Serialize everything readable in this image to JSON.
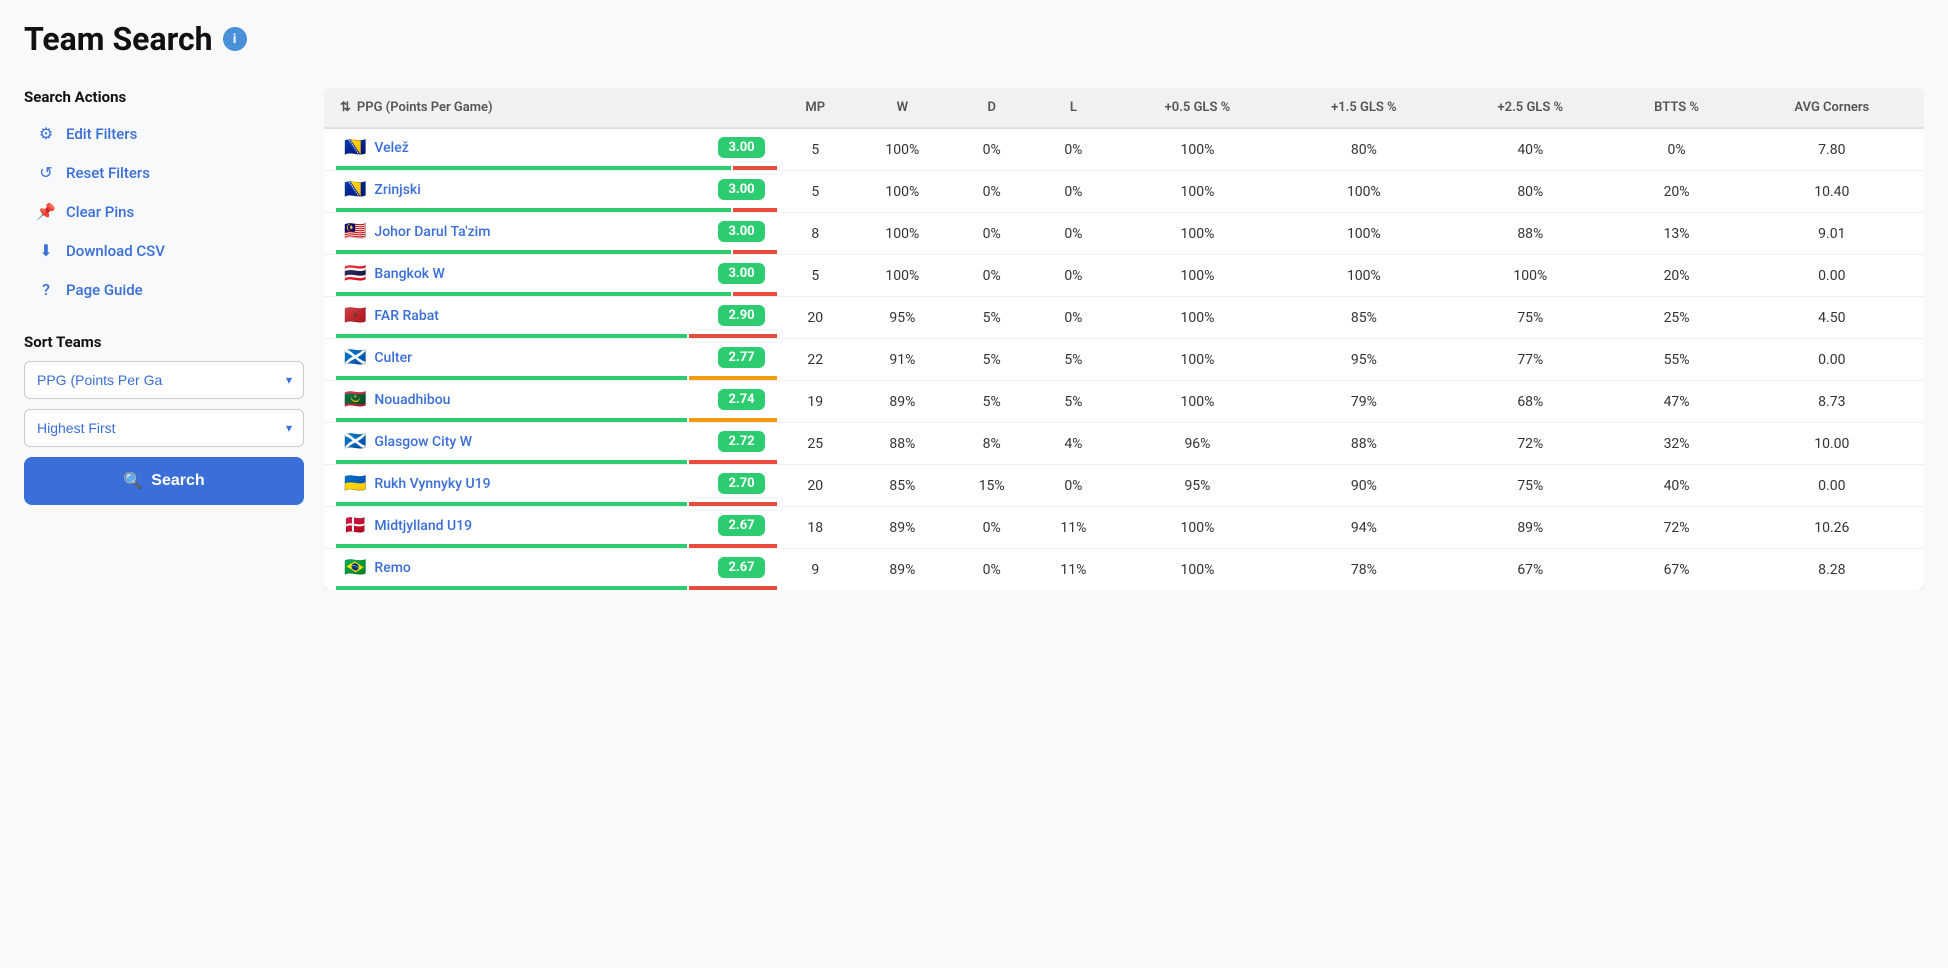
{
  "page": {
    "title": "Team Search",
    "info_icon": "i"
  },
  "sidebar": {
    "search_actions_label": "Search Actions",
    "actions": [
      {
        "id": "edit-filters",
        "label": "Edit Filters",
        "icon": "⚙"
      },
      {
        "id": "reset-filters",
        "label": "Reset Filters",
        "icon": "↺"
      },
      {
        "id": "clear-pins",
        "label": "Clear Pins",
        "icon": "📌"
      },
      {
        "id": "download-csv",
        "label": "Download CSV",
        "icon": "⬇"
      },
      {
        "id": "page-guide",
        "label": "Page Guide",
        "icon": "?"
      }
    ],
    "sort_label": "Sort Teams",
    "sort_by_label": "PPG (Points Per Ga",
    "sort_order_label": "Highest First",
    "search_button_label": "Search"
  },
  "table": {
    "sort_column_label": "PPG (Points Per Game)",
    "columns": [
      "MP",
      "W",
      "D",
      "L",
      "+0.5 GLS %",
      "+1.5 GLS %",
      "+2.5 GLS %",
      "BTTS %",
      "AVG Corners"
    ],
    "rows": [
      {
        "flag": "🇧🇦",
        "name": "Velež",
        "ppg": "3.00",
        "mp": 5,
        "w": "100%",
        "d": "0%",
        "l": "0%",
        "gls05": "100%",
        "gls15": "80%",
        "gls25": "40%",
        "btts": "0%",
        "avg_corners": "7.80",
        "bar": "green-heavy"
      },
      {
        "flag": "🇧🇦",
        "name": "Zrinjski",
        "ppg": "3.00",
        "mp": 5,
        "w": "100%",
        "d": "0%",
        "l": "0%",
        "gls05": "100%",
        "gls15": "100%",
        "gls25": "80%",
        "btts": "20%",
        "avg_corners": "10.40",
        "bar": "green-heavy"
      },
      {
        "flag": "🇲🇾",
        "name": "Johor Darul Ta'zim",
        "ppg": "3.00",
        "mp": 8,
        "w": "100%",
        "d": "0%",
        "l": "0%",
        "gls05": "100%",
        "gls15": "100%",
        "gls25": "88%",
        "btts": "13%",
        "avg_corners": "9.01",
        "bar": "green-heavy"
      },
      {
        "flag": "🇹🇭",
        "name": "Bangkok W",
        "ppg": "3.00",
        "mp": 5,
        "w": "100%",
        "d": "0%",
        "l": "0%",
        "gls05": "100%",
        "gls15": "100%",
        "gls25": "100%",
        "btts": "20%",
        "avg_corners": "0.00",
        "bar": "green-heavy"
      },
      {
        "flag": "🇲🇦",
        "name": "FAR Rabat",
        "ppg": "2.90",
        "mp": 20,
        "w": "95%",
        "d": "5%",
        "l": "0%",
        "gls05": "100%",
        "gls15": "85%",
        "gls25": "75%",
        "btts": "25%",
        "avg_corners": "4.50",
        "bar": "green-red"
      },
      {
        "flag": "🏴󠁧󠁢󠁳󠁣󠁴󠁿",
        "name": "Culter",
        "ppg": "2.77",
        "mp": 22,
        "w": "91%",
        "d": "5%",
        "l": "5%",
        "gls05": "100%",
        "gls15": "95%",
        "gls25": "77%",
        "btts": "55%",
        "avg_corners": "0.00",
        "bar": "green-orange"
      },
      {
        "flag": "🇲🇷",
        "name": "Nouadhibou",
        "ppg": "2.74",
        "mp": 19,
        "w": "89%",
        "d": "5%",
        "l": "5%",
        "gls05": "100%",
        "gls15": "79%",
        "gls25": "68%",
        "btts": "47%",
        "avg_corners": "8.73",
        "bar": "green-orange"
      },
      {
        "flag": "🏴󠁧󠁢󠁳󠁣󠁴󠁿",
        "name": "Glasgow City W",
        "ppg": "2.72",
        "mp": 25,
        "w": "88%",
        "d": "8%",
        "l": "4%",
        "gls05": "96%",
        "gls15": "88%",
        "gls25": "72%",
        "btts": "32%",
        "avg_corners": "10.00",
        "bar": "green-red"
      },
      {
        "flag": "🇺🇦",
        "name": "Rukh Vynnyky U19",
        "ppg": "2.70",
        "mp": 20,
        "w": "85%",
        "d": "15%",
        "l": "0%",
        "gls05": "95%",
        "gls15": "90%",
        "gls25": "75%",
        "btts": "40%",
        "avg_corners": "0.00",
        "bar": "green-red"
      },
      {
        "flag": "🇩🇰",
        "name": "Midtjylland U19",
        "ppg": "2.67",
        "mp": 18,
        "w": "89%",
        "d": "0%",
        "l": "11%",
        "gls05": "100%",
        "gls15": "94%",
        "gls25": "89%",
        "btts": "72%",
        "avg_corners": "10.26",
        "bar": "green-red"
      },
      {
        "flag": "🇧🇷",
        "name": "Remo",
        "ppg": "2.67",
        "mp": 9,
        "w": "89%",
        "d": "0%",
        "l": "11%",
        "gls05": "100%",
        "gls15": "78%",
        "gls25": "67%",
        "btts": "67%",
        "avg_corners": "8.28",
        "bar": "green-red"
      }
    ]
  }
}
